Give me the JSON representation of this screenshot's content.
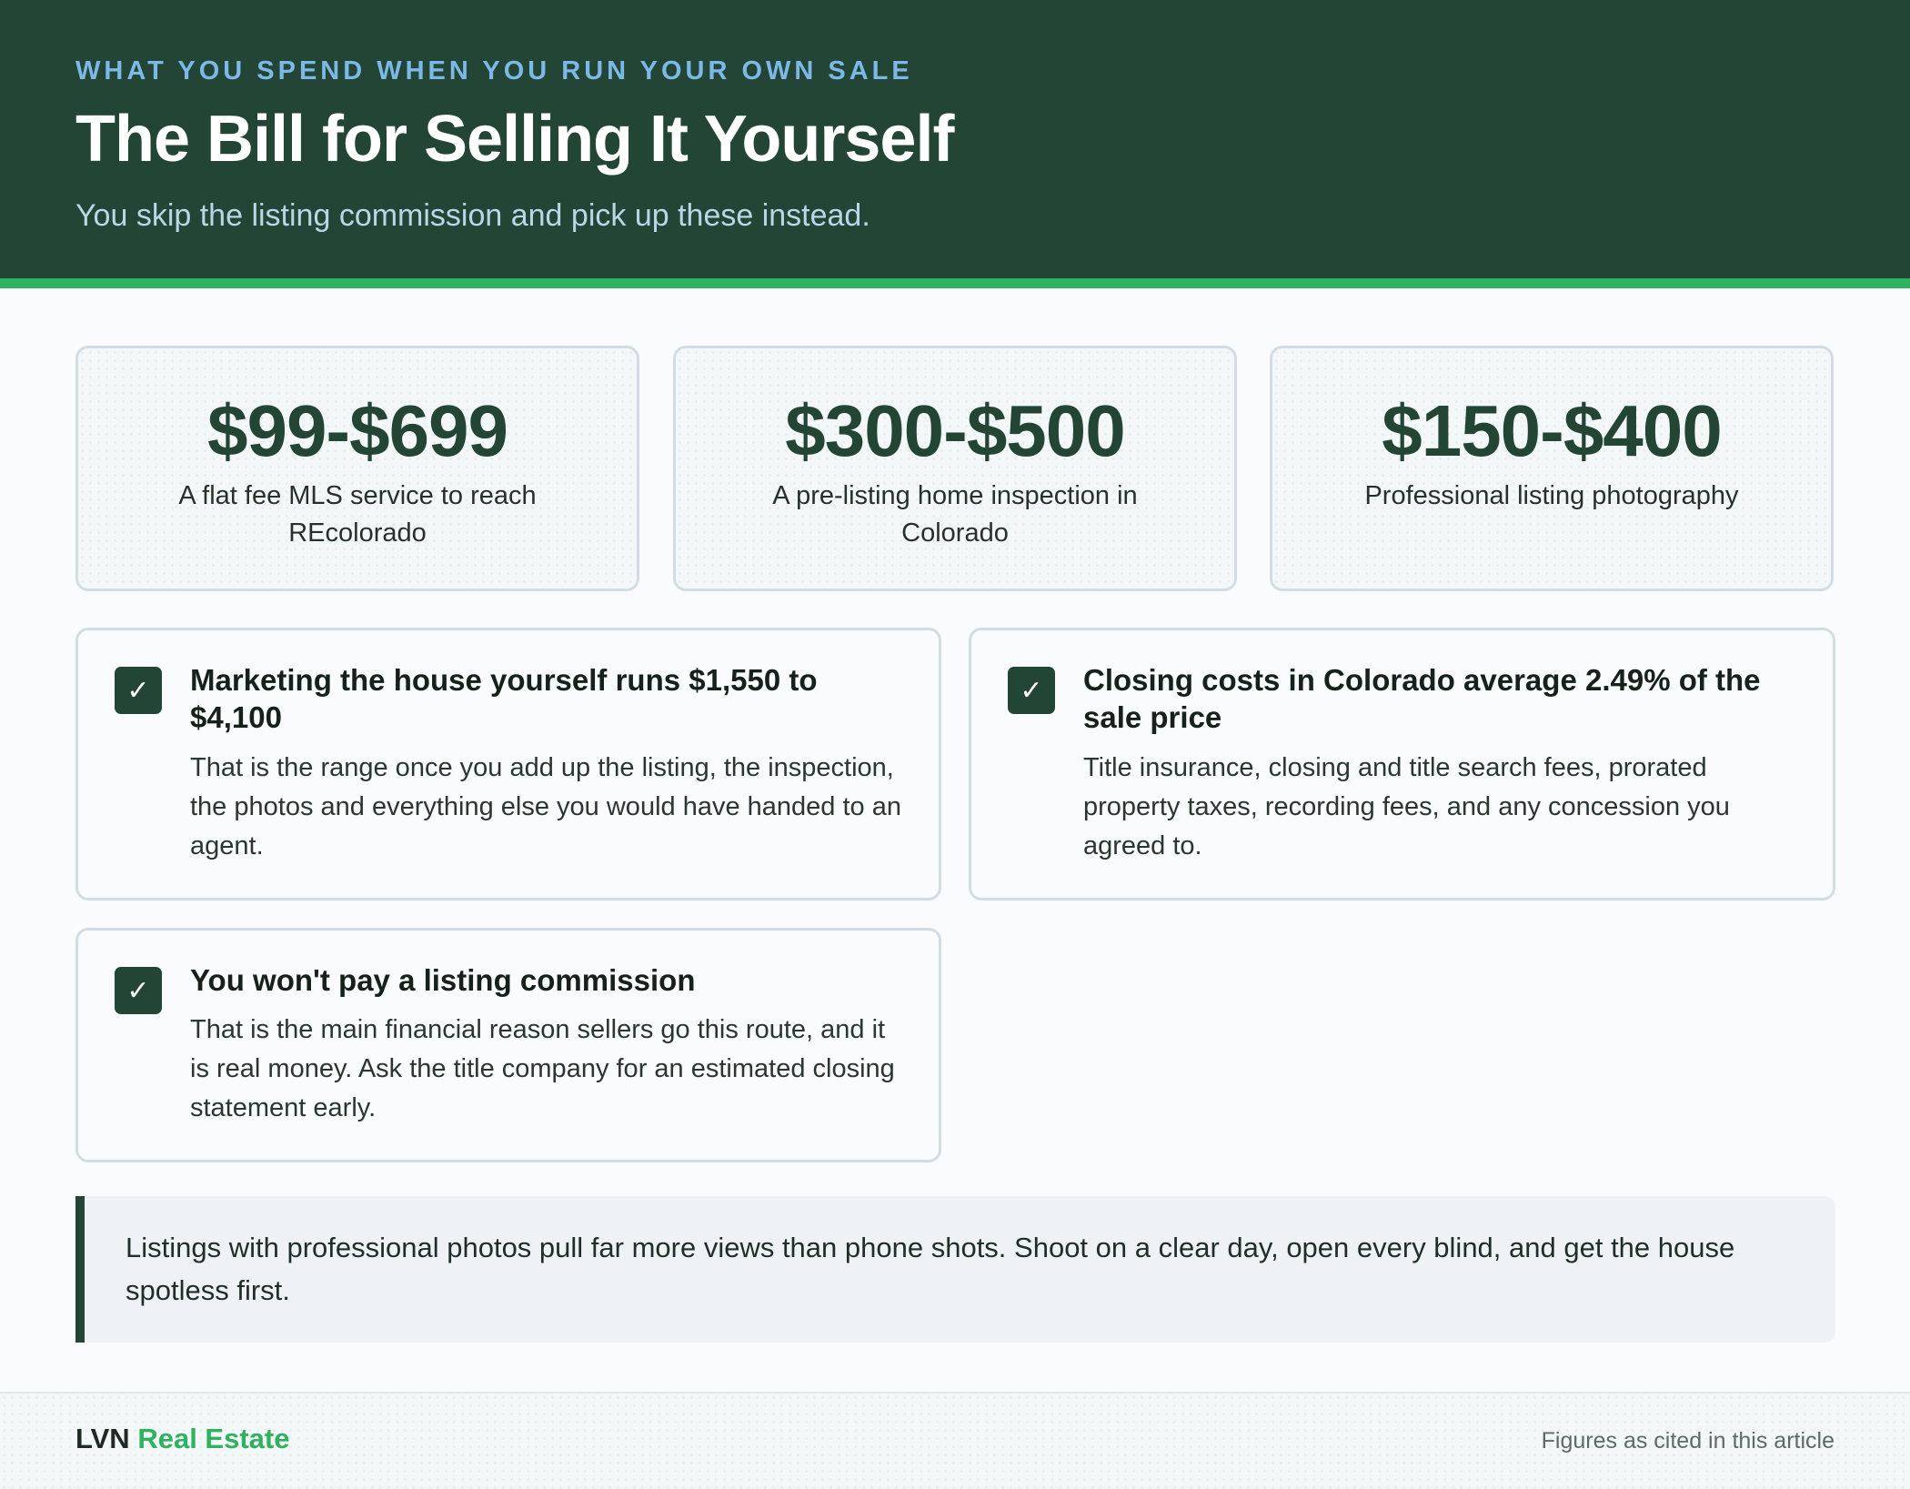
{
  "header": {
    "eyebrow": "WHAT YOU SPEND WHEN YOU RUN YOUR OWN SALE",
    "title": "The Bill for Selling It Yourself",
    "subtitle": "You skip the listing commission and pick up these instead."
  },
  "stats": [
    {
      "value": "$99-$699",
      "label": "A flat fee MLS service to reach REcolorado"
    },
    {
      "value": "$300-$500",
      "label": "A pre-listing home inspection in Colorado"
    },
    {
      "value": "$150-$400",
      "label": "Professional listing photography"
    }
  ],
  "checks": [
    {
      "icon": "checkmark-icon",
      "title": "Marketing the house yourself runs $1,550 to $4,100",
      "body": "That is the range once you add up the listing, the inspection, the photos and everything else you would have handed to an agent."
    },
    {
      "icon": "checkmark-icon",
      "title": "Closing costs in Colorado average 2.49% of the sale price",
      "body": "Title insurance, closing and title search fees, prorated property taxes, recording fees, and any concession you agreed to."
    },
    {
      "icon": "checkmark-icon",
      "title": "You won't pay a listing commission",
      "body": "That is the main financial reason sellers go this route, and it is real money. Ask the title company for an estimated closing statement early."
    }
  ],
  "tip": {
    "text": "Listings with professional photos pull far more views than phone shots. Shoot on a clear day, open every blind, and get the house spotless first."
  },
  "footer": {
    "brand_part1": "LVN",
    "brand_part2": "Real Estate",
    "note": "Figures as cited in this article"
  },
  "colors": {
    "header_bg": "#234535",
    "accent_green": "#2fb260",
    "eyebrow_blue": "#7cb9e6"
  }
}
